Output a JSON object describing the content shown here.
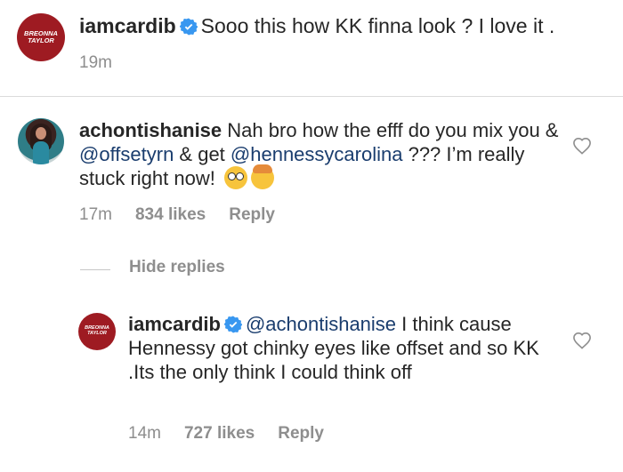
{
  "post": {
    "avatar_text": "BREONNA\nTAYLOR",
    "username": "iamcardib",
    "caption": "Sooo this how KK finna look ? I love it .",
    "time": "19m"
  },
  "comment": {
    "username": "achontishanise",
    "text_1": "Nah bro how the efff do you mix you & ",
    "mention_1": "@offsetyrn",
    "text_2": " & get ",
    "mention_2": "@hennessycarolina",
    "text_3": " ??? I’m really stuck right now!",
    "emojis": [
      "flushed-face",
      "exploding-head"
    ],
    "time": "17m",
    "likes": "834 likes",
    "reply_label": "Reply"
  },
  "hide_replies_label": "Hide replies",
  "reply": {
    "avatar_text": "BREONNA\nTAYLOR",
    "username": "iamcardib",
    "mention": "@achontishanise",
    "text": " I think cause Hennessy got chinky eyes like offset and so KK .Its the only think I could think off",
    "time": "14m",
    "likes": "727 likes",
    "reply_label": "Reply"
  },
  "colors": {
    "verified": "#3897f0",
    "avatar_bg": "#9e1b22",
    "mention": "#1a3d6e",
    "meta": "#8e8e8e"
  }
}
